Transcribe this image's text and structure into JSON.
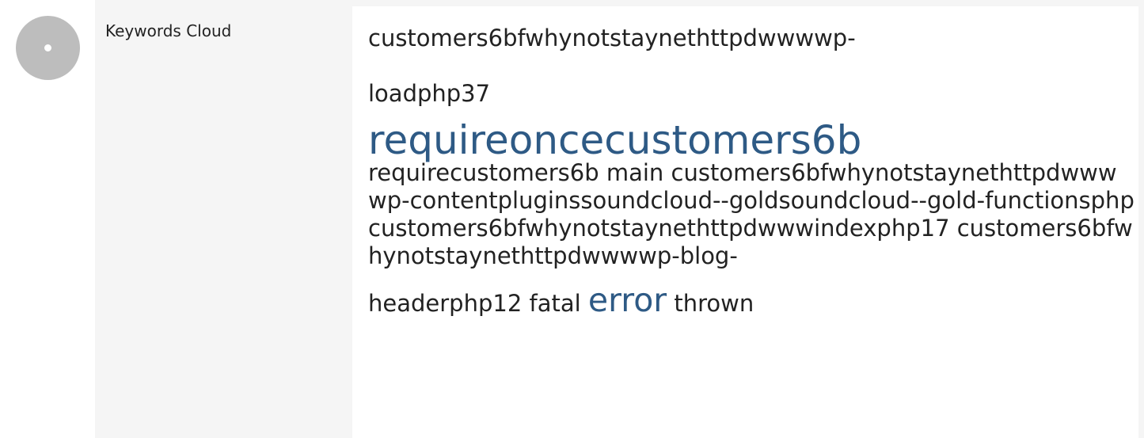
{
  "section": {
    "label": "Keywords Cloud",
    "status_icon": "circle-dot-icon",
    "status_color": "#bdbdbd"
  },
  "cloud": {
    "accent_color": "#2e5a85",
    "line1": "customers6bfwhynotstaynethttpdwwwwp-",
    "line2": "loadphp37",
    "big_keyword": "requireoncecustomers6b",
    "block_text": "requirecustomers6b main customers6bfwhynotstaynethttpdwwwwp-contentpluginssoundcloud--goldsoundcloud--gold-functionsphp customers6bfwhynotstaynethttpdwwwindexphp17 customers6bfwhynotstaynethttpdwwwwp-blog-",
    "tail_before": "headerphp12 fatal",
    "medium_keyword": "error",
    "tail_after": "thrown"
  }
}
